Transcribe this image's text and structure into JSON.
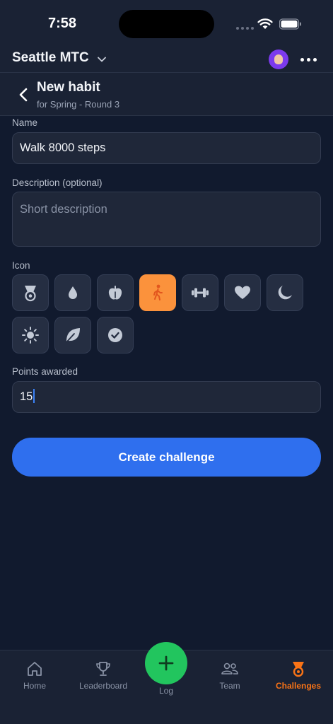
{
  "status": {
    "time": "7:58"
  },
  "header": {
    "team_name": "Seattle MTC"
  },
  "subheader": {
    "title": "New habit",
    "subtitle": "for Spring - Round 3"
  },
  "form": {
    "name_label": "Name",
    "name_value": "Walk 8000 steps",
    "description_label": "Description (optional)",
    "description_placeholder": "Short description",
    "icon_label": "Icon",
    "icons": [
      {
        "name": "medal-icon",
        "selected": false
      },
      {
        "name": "water-drop-icon",
        "selected": false
      },
      {
        "name": "apple-icon",
        "selected": false
      },
      {
        "name": "walking-icon",
        "selected": true
      },
      {
        "name": "dumbbell-icon",
        "selected": false
      },
      {
        "name": "heart-icon",
        "selected": false
      },
      {
        "name": "moon-icon",
        "selected": false
      },
      {
        "name": "sun-icon",
        "selected": false
      },
      {
        "name": "leaf-icon",
        "selected": false
      },
      {
        "name": "check-circle-icon",
        "selected": false
      }
    ],
    "points_label": "Points awarded",
    "points_value": "15",
    "submit_label": "Create challenge"
  },
  "tabs": {
    "home": "Home",
    "leaderboard": "Leaderboard",
    "log": "Log",
    "team": "Team",
    "challenges": "Challenges",
    "active": "challenges"
  },
  "colors": {
    "background": "#111a2e",
    "accent_blue": "#2f6fee",
    "selected_icon": "#fb923c",
    "active_tab": "#f97316",
    "log_fab": "#22c55e"
  }
}
